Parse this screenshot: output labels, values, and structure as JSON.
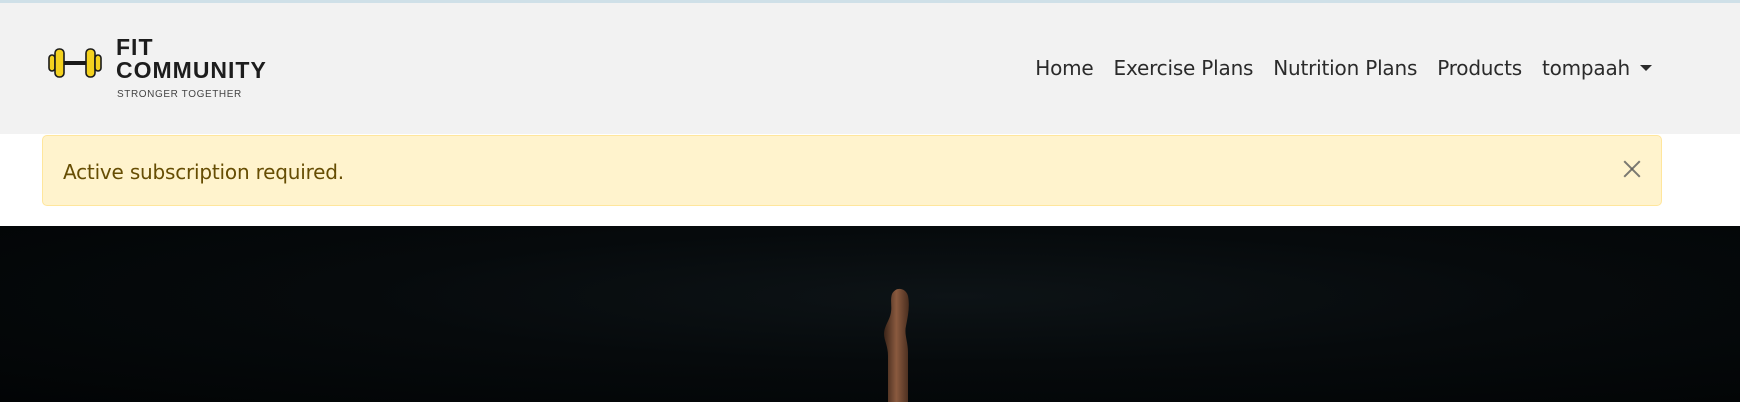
{
  "brand": {
    "title_line1": "FIT",
    "title_line2": "COMMUNITY",
    "tagline": "STRONGER TOGETHER",
    "icon": "dumbbell-icon",
    "accent_color": "#f4d21f"
  },
  "nav": {
    "items": [
      {
        "label": "Home"
      },
      {
        "label": "Exercise Plans"
      },
      {
        "label": "Nutrition Plans"
      },
      {
        "label": "Products"
      }
    ],
    "user": {
      "label": "tompaah",
      "icon": "caret-down-icon"
    }
  },
  "alert": {
    "message": "Active subscription required.",
    "close_icon": "close-icon",
    "background": "#fff3cd",
    "text_color": "#664d03"
  },
  "hero": {
    "background": "#05090b"
  }
}
